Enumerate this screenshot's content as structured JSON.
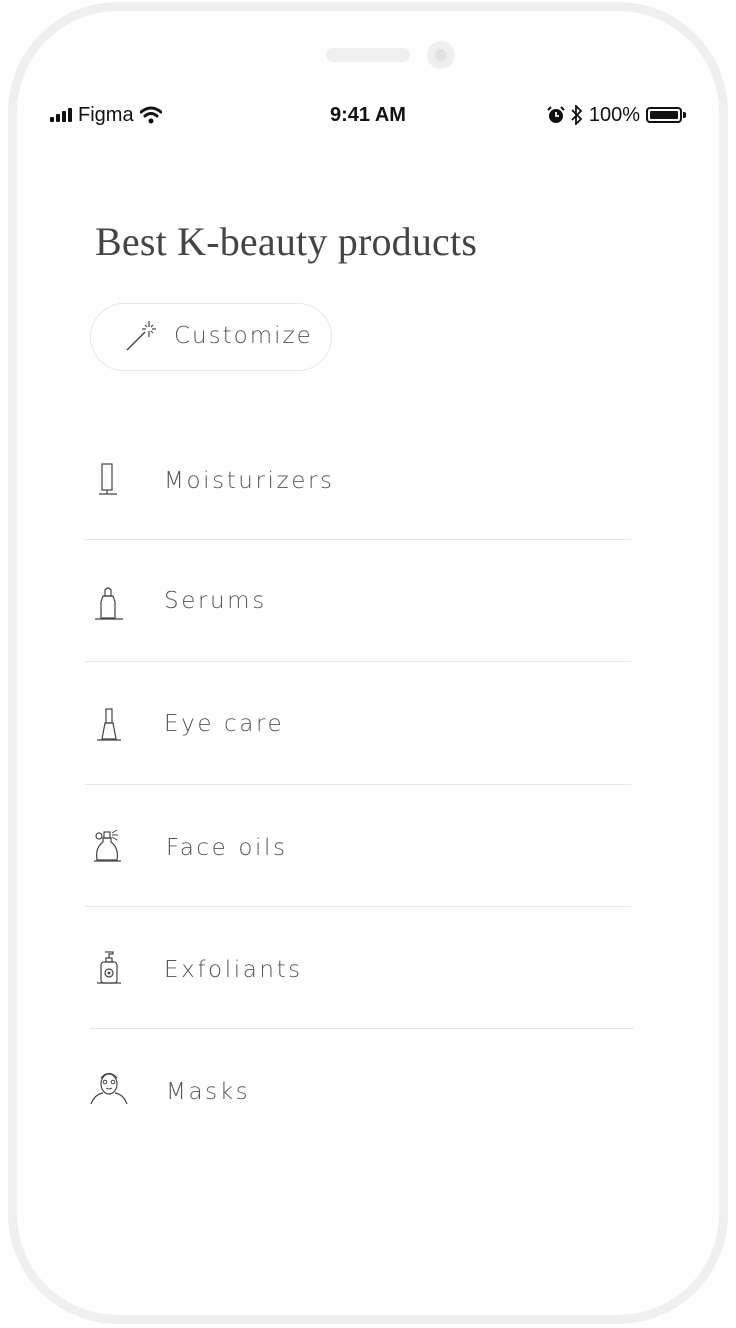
{
  "status_bar": {
    "carrier": "Figma",
    "time": "9:41 AM",
    "battery_percent": "100%",
    "icons": [
      "signal-icon",
      "wifi-icon",
      "alarm-icon",
      "bluetooth-icon",
      "battery-icon"
    ]
  },
  "page": {
    "title": "Best K-beauty products"
  },
  "customize_button": {
    "label": "Customize",
    "icon": "magic-wand-icon"
  },
  "categories": [
    {
      "label": "Moisturizers",
      "icon": "tube-icon"
    },
    {
      "label": "Serums",
      "icon": "serum-bottle-icon"
    },
    {
      "label": "Eye care",
      "icon": "eye-care-bottle-icon"
    },
    {
      "label": "Face oils",
      "icon": "spray-bottle-icon"
    },
    {
      "label": "Exfoliants",
      "icon": "pump-bottle-icon"
    },
    {
      "label": "Masks",
      "icon": "face-mask-icon"
    }
  ],
  "colors": {
    "text": "#555555",
    "title": "#444444",
    "divider": "#e8e8e8",
    "frame": "#efefef"
  }
}
